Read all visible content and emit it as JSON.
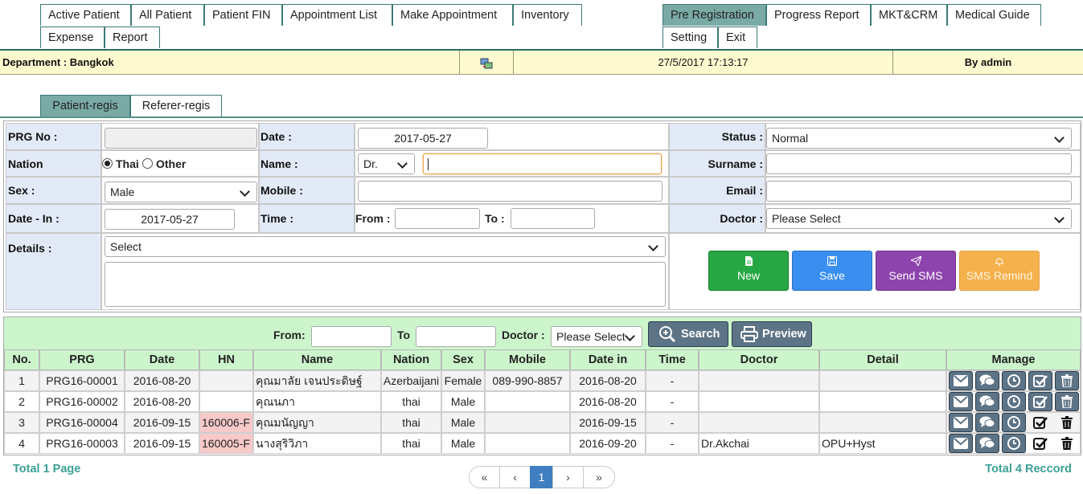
{
  "nav": {
    "row1_left": [
      "Active Patient",
      "All Patient",
      "Patient FIN",
      "Appointment List",
      "Make Appointment",
      "Inventory"
    ],
    "row1_right": [
      "Pre Registration",
      "Progress Report",
      "MKT&CRM",
      "Medical Guide"
    ],
    "row2_left": [
      "Expense",
      "Report"
    ],
    "row2_right": [
      "Setting",
      "Exit"
    ],
    "active": "Pre Registration"
  },
  "infobar": {
    "department": "Department : Bangkok",
    "datetime": "27/5/2017 17:13:17",
    "user": "By admin"
  },
  "subtabs": {
    "patient": "Patient-regis",
    "referer": "Referer-regis",
    "active": "Patient-regis"
  },
  "form": {
    "prg_label": "PRG No :",
    "prg_value": "",
    "date_label": "Date :",
    "date_value": "2017-05-27",
    "status_label": "Status :",
    "status_value": "Normal",
    "nation_label": "Nation",
    "nation_thai": "Thai",
    "nation_other": "Other",
    "nation_selected": "Thai",
    "name_label": "Name :",
    "title_value": "Dr.",
    "name_value": "",
    "surname_label": "Surname :",
    "surname_value": "",
    "sex_label": "Sex :",
    "sex_value": "Male",
    "mobile_label": "Mobile :",
    "mobile_value": "",
    "email_label": "Email :",
    "email_value": "",
    "datein_label": "Date - In :",
    "datein_value": "2017-05-27",
    "time_label": "Time :",
    "from_label": "From :",
    "from_value": "",
    "to_label": "To :",
    "to_value": "",
    "doctor_label": "Doctor :",
    "doctor_value": "Please Select",
    "details_label": "Details :",
    "details_select": "Select",
    "details_text": "",
    "buttons": {
      "new": "New",
      "save": "Save",
      "sms": "Send SMS",
      "remind": "SMS Remind"
    },
    "colors": {
      "new": "#27a744",
      "save": "#3a8ef0",
      "sms": "#8e44ad",
      "remind": "#f5b14c"
    }
  },
  "search": {
    "from_label": "From:",
    "from_value": "",
    "to_label": "To",
    "to_value": "",
    "doctor_label": "Doctor :",
    "doctor_value": "Please Select",
    "search_button": "Search",
    "preview_button": "Preview"
  },
  "table": {
    "headers": [
      "No.",
      "PRG",
      "Date",
      "HN",
      "Name",
      "Nation",
      "Sex",
      "Mobile",
      "Date in",
      "Time",
      "Doctor",
      "Detail",
      "Manage"
    ],
    "rows": [
      {
        "no": "1",
        "prg": "PRG16-00001",
        "date": "2016-08-20",
        "hn": "",
        "name": "คุณมาลัย เจนประดิษฐ์",
        "nation": "Azerbaijani",
        "sex": "Female",
        "mobile": "089-990-8857",
        "datein": "2016-08-20",
        "time": "-",
        "doctor": "",
        "detail": ""
      },
      {
        "no": "2",
        "prg": "PRG16-00002",
        "date": "2016-08-20",
        "hn": "",
        "name": "คุณนภา",
        "nation": "thai",
        "sex": "Male",
        "mobile": "",
        "datein": "2016-08-20",
        "time": "-",
        "doctor": "",
        "detail": ""
      },
      {
        "no": "3",
        "prg": "PRG16-00004",
        "date": "2016-09-15",
        "hn": "160006-F",
        "name": "คุณมนัญญา",
        "nation": "thai",
        "sex": "Male",
        "mobile": "",
        "datein": "2016-09-15",
        "time": "-",
        "doctor": "",
        "detail": ""
      },
      {
        "no": "4",
        "prg": "PRG16-00003",
        "date": "2016-09-15",
        "hn": "160005-F",
        "name": "นางสุริวิภา",
        "nation": "thai",
        "sex": "Male",
        "mobile": "",
        "datein": "2016-09-20",
        "time": "-",
        "doctor": "Dr.Akchai",
        "detail": "OPU+Hyst"
      }
    ],
    "manage_icons": [
      "envelope-icon",
      "chat-icon",
      "clock-icon",
      "check-icon",
      "trash-icon"
    ]
  },
  "footer": {
    "total_pages": "Total 1 Page",
    "total_records": "Total 4 Reccord",
    "pager": [
      "«",
      "‹",
      "1",
      "›",
      "»"
    ],
    "current_page": "1"
  }
}
